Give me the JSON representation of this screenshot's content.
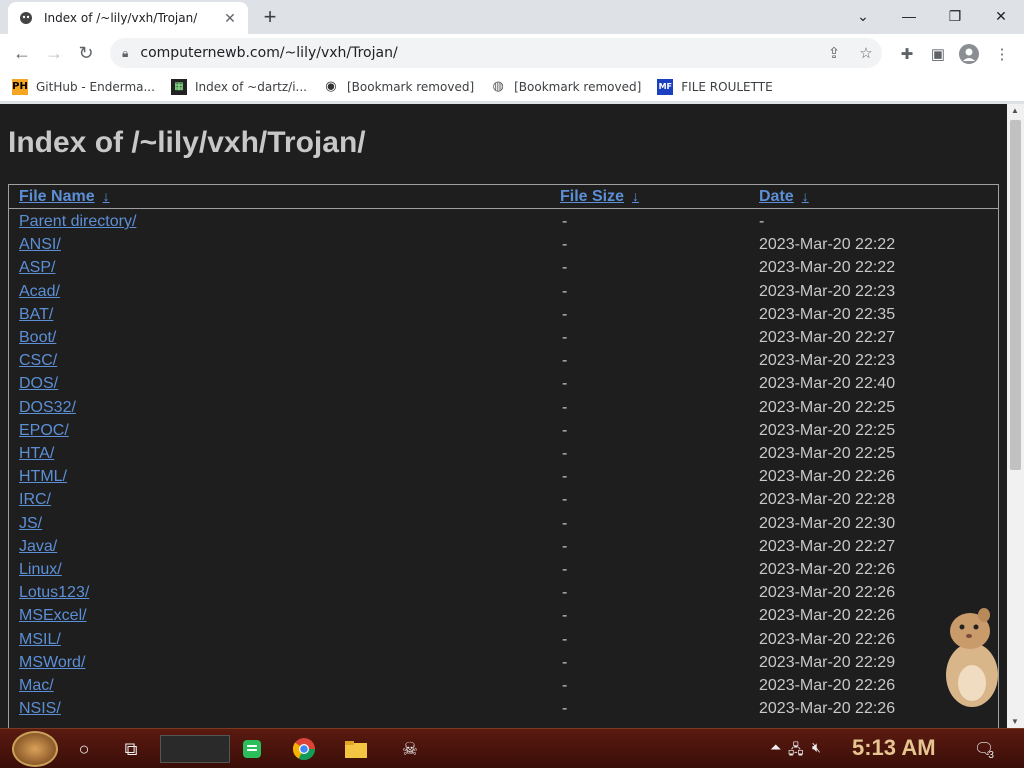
{
  "browser": {
    "tab_title": "Index of /~lily/vxh/Trojan/",
    "tab_close": "✕",
    "new_tab": "+",
    "url": "computernewb.com/~lily/vxh/Trojan/",
    "window_controls": {
      "minimize": "—",
      "restore": "❐",
      "close": "✕",
      "tab_search": "⌄"
    },
    "bookmarks": [
      {
        "label": "GitHub - Enderma...",
        "icon": "PH",
        "icon_bg": "#f5a623"
      },
      {
        "label": "Index of ~dartz/i...",
        "icon": "▦",
        "icon_bg": "#222222"
      },
      {
        "label": "[Bookmark removed]",
        "icon": "◉",
        "icon_bg": "#ffffff"
      },
      {
        "label": "[Bookmark removed]",
        "icon": "◍",
        "icon_bg": "#ffffff"
      },
      {
        "label": "FILE ROULETTE",
        "icon": "MF",
        "icon_bg": "#1a3fbf"
      }
    ]
  },
  "page": {
    "heading": "Index of /~lily/vxh/Trojan/",
    "columns": {
      "name": "File Name",
      "size": "File Size",
      "date": "Date",
      "sort_glyph": "↓"
    },
    "rows": [
      {
        "name": "Parent directory/",
        "size": "-",
        "date": "-"
      },
      {
        "name": "ANSI/",
        "size": "-",
        "date": "2023-Mar-20 22:22"
      },
      {
        "name": "ASP/",
        "size": "-",
        "date": "2023-Mar-20 22:22"
      },
      {
        "name": "Acad/",
        "size": "-",
        "date": "2023-Mar-20 22:23"
      },
      {
        "name": "BAT/",
        "size": "-",
        "date": "2023-Mar-20 22:35"
      },
      {
        "name": "Boot/",
        "size": "-",
        "date": "2023-Mar-20 22:27"
      },
      {
        "name": "CSC/",
        "size": "-",
        "date": "2023-Mar-20 22:23"
      },
      {
        "name": "DOS/",
        "size": "-",
        "date": "2023-Mar-20 22:40"
      },
      {
        "name": "DOS32/",
        "size": "-",
        "date": "2023-Mar-20 22:25"
      },
      {
        "name": "EPOC/",
        "size": "-",
        "date": "2023-Mar-20 22:25"
      },
      {
        "name": "HTA/",
        "size": "-",
        "date": "2023-Mar-20 22:25"
      },
      {
        "name": "HTML/",
        "size": "-",
        "date": "2023-Mar-20 22:26"
      },
      {
        "name": "IRC/",
        "size": "-",
        "date": "2023-Mar-20 22:28"
      },
      {
        "name": "JS/",
        "size": "-",
        "date": "2023-Mar-20 22:30"
      },
      {
        "name": "Java/",
        "size": "-",
        "date": "2023-Mar-20 22:27"
      },
      {
        "name": "Linux/",
        "size": "-",
        "date": "2023-Mar-20 22:26"
      },
      {
        "name": "Lotus123/",
        "size": "-",
        "date": "2023-Mar-20 22:26"
      },
      {
        "name": "MSExcel/",
        "size": "-",
        "date": "2023-Mar-20 22:26"
      },
      {
        "name": "MSIL/",
        "size": "-",
        "date": "2023-Mar-20 22:26"
      },
      {
        "name": "MSWord/",
        "size": "-",
        "date": "2023-Mar-20 22:29"
      },
      {
        "name": "Mac/",
        "size": "-",
        "date": "2023-Mar-20 22:26"
      },
      {
        "name": "NSIS/",
        "size": "-",
        "date": "2023-Mar-20 22:26"
      }
    ]
  },
  "taskbar": {
    "clock": "5:13 AM",
    "notification_count": "3"
  },
  "colors": {
    "link": "#5c8fd6",
    "page_bg": "#1e1e1e",
    "text": "#c8c8c8"
  }
}
